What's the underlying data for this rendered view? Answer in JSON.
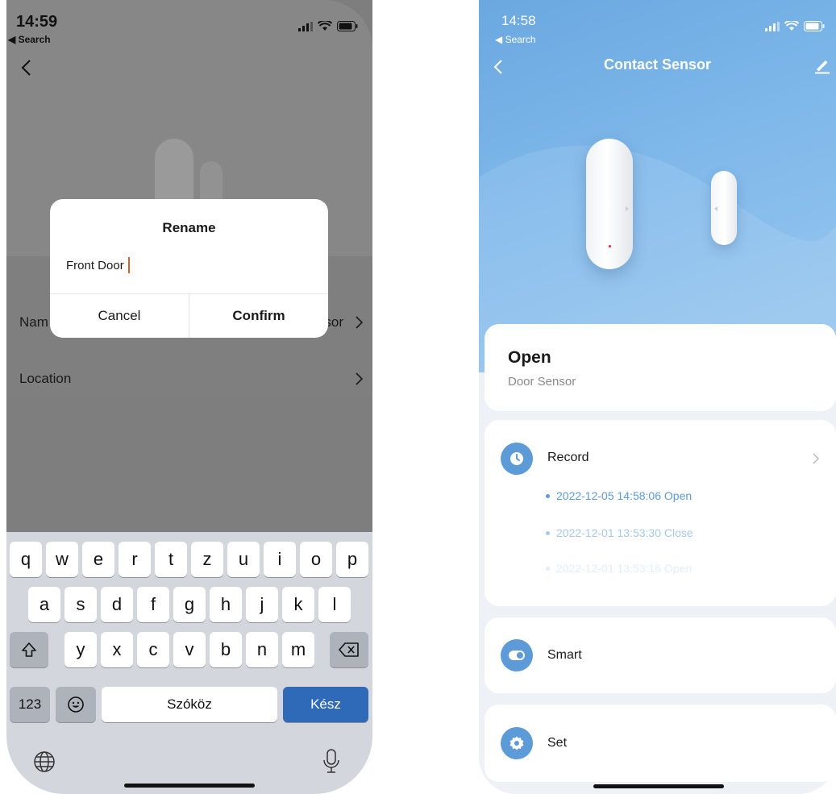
{
  "left": {
    "status": {
      "time": "14:59",
      "back_label": "◀ Search"
    },
    "settings": {
      "name_label": "Nam",
      "name_value": "sor",
      "location_label": "Location"
    },
    "dialog": {
      "title": "Rename",
      "input_value": "Front Door",
      "cancel_label": "Cancel",
      "confirm_label": "Confirm"
    },
    "keyboard": {
      "row1": [
        "q",
        "w",
        "e",
        "r",
        "t",
        "z",
        "u",
        "i",
        "o",
        "p"
      ],
      "row2": [
        "a",
        "s",
        "d",
        "f",
        "g",
        "h",
        "j",
        "k",
        "l"
      ],
      "row3": [
        "y",
        "x",
        "c",
        "v",
        "b",
        "n",
        "m"
      ],
      "numbers_label": "123",
      "space_label": "Szóköz",
      "done_label": "Kész"
    }
  },
  "right": {
    "status": {
      "time": "14:58",
      "back_label": "◀ Search"
    },
    "header": {
      "title": "Contact Sensor"
    },
    "status_card": {
      "state": "Open",
      "device_type": "Door Sensor"
    },
    "record": {
      "label": "Record",
      "entries": [
        "2022-12-05 14:58:06 Open",
        "2022-12-01 13:53:30 Close",
        "2022-12-01 13:53:16 Open"
      ]
    },
    "smart": {
      "label": "Smart"
    },
    "set": {
      "label": "Set"
    }
  },
  "colors": {
    "accent_blue": "#5c9ad8",
    "done_key_blue": "#2f6ab8",
    "caret": "#e05a2b"
  }
}
